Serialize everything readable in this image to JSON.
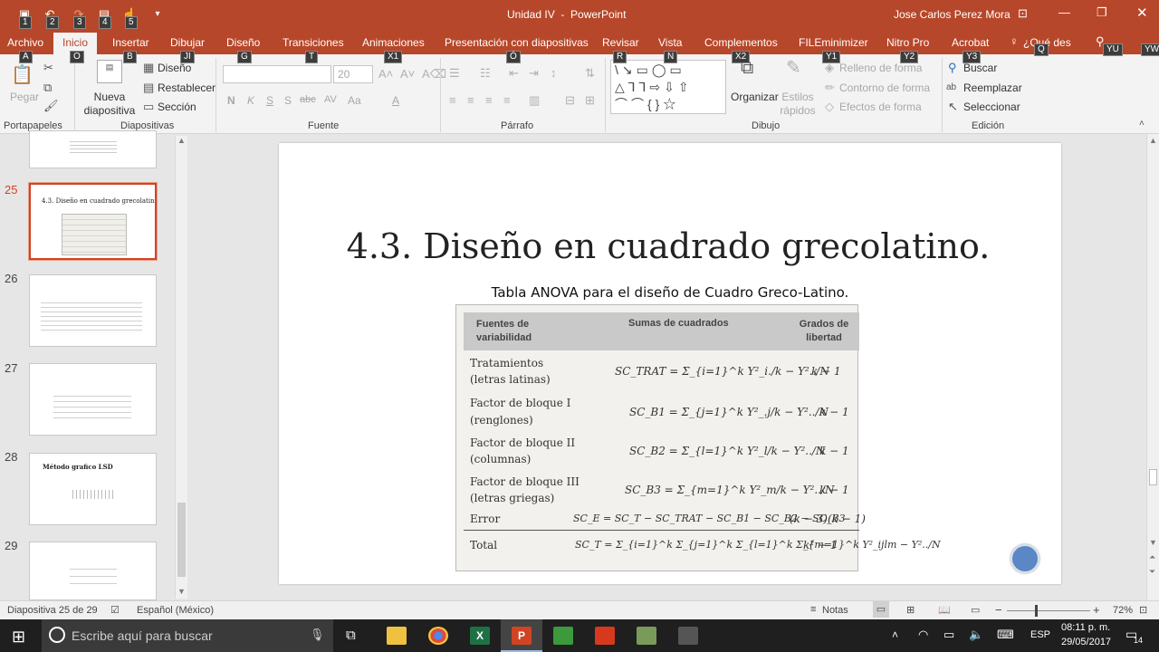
{
  "titlebar": {
    "title": "Unidad IV  -  PowerPoint",
    "user": "Jose Carlos Perez Mora",
    "qat_keytips": [
      "1",
      "2",
      "3",
      "4",
      "5"
    ]
  },
  "tabs": [
    {
      "label": "Archivo",
      "keytip": "A"
    },
    {
      "label": "Inicio",
      "keytip": "O"
    },
    {
      "label": "Insertar",
      "keytip": "B"
    },
    {
      "label": "Dibujar",
      "keytip": "JI"
    },
    {
      "label": "Diseño",
      "keytip": "G"
    },
    {
      "label": "Transiciones",
      "keytip": "T"
    },
    {
      "label": "Animaciones",
      "keytip": "X1"
    },
    {
      "label": "Presentación con diapositivas",
      "keytip": "Ó"
    },
    {
      "label": "Revisar",
      "keytip": "R"
    },
    {
      "label": "Vista",
      "keytip": "N"
    },
    {
      "label": "Complementos",
      "keytip": "X2"
    },
    {
      "label": "FILEminimizer",
      "keytip": "Y1"
    },
    {
      "label": "Nitro Pro",
      "keytip": "Y2"
    },
    {
      "label": "Acrobat",
      "keytip": "Y3"
    },
    {
      "label": "¿Qué des",
      "keytip": "Q"
    },
    {
      "label": "",
      "keytip": "YU"
    },
    {
      "label": "",
      "keytip": "YW"
    }
  ],
  "ribbon": {
    "paste": "Pegar",
    "new_slide": "Nueva diapositiva",
    "layout": "Diseño",
    "reset": "Restablecer",
    "section": "Sección",
    "font_size": "20",
    "arrange": "Organizar",
    "quick_styles": "Estilos rápidos",
    "shape_fill": "Relleno de forma",
    "shape_outline": "Contorno de forma",
    "shape_effects": "Efectos de forma",
    "find": "Buscar",
    "replace": "Reemplazar",
    "select": "Seleccionar",
    "groups": {
      "clipboard": "Portapapeles",
      "slides": "Diapositivas",
      "font": "Fuente",
      "paragraph": "Párrafo",
      "drawing": "Dibujo",
      "editing": "Edición"
    },
    "font_buttons": [
      "N",
      "K",
      "S",
      "S",
      "abc",
      "AV",
      "Aa",
      "A"
    ]
  },
  "thumbnails": [
    {
      "num": "",
      "text": ""
    },
    {
      "num": "25",
      "text": "4.3. Diseño en cuadrado grecolatino."
    },
    {
      "num": "26",
      "text": ""
    },
    {
      "num": "27",
      "text": ""
    },
    {
      "num": "28",
      "text": "Método grafico LSD"
    },
    {
      "num": "29",
      "text": ""
    }
  ],
  "slide": {
    "title": "4.3. Diseño en cuadrado grecolatino.",
    "subtitle": "Tabla ANOVA para el diseño de Cuadro Greco-Latino.",
    "table": {
      "headers": [
        "Fuentes de variabilidad",
        "Sumas de cuadrados",
        "Grados de libertad"
      ],
      "rows": [
        {
          "source": [
            "Tratamientos",
            "(letras latinas)"
          ],
          "ss": "SC_TRAT = Σ_{i=1}^k Y²_i./k − Y²../N",
          "df": "k − 1"
        },
        {
          "source": [
            "Factor de bloque I",
            "(renglones)"
          ],
          "ss": "SC_B1 = Σ_{j=1}^k Y²_.j/k − Y²../N",
          "df": "k − 1"
        },
        {
          "source": [
            "Factor de bloque II",
            "(columnas)"
          ],
          "ss": "SC_B2 = Σ_{l=1}^k Y²_l/k − Y²../N",
          "df": "k − 1"
        },
        {
          "source": [
            "Factor de bloque III",
            "(letras griegas)"
          ],
          "ss": "SC_B3 = Σ_{m=1}^k Y²_m/k − Y²../N",
          "df": "k − 1"
        },
        {
          "source": [
            "Error"
          ],
          "ss": "SC_E = SC_T − SC_TRAT − SC_B1 − SC_B2 − SC_B3",
          "df": "(k − 3)(k − 1)"
        },
        {
          "source": [
            "Total"
          ],
          "ss": "SC_T = Σ_{i=1}^k Σ_{j=1}^k Σ_{l=1}^k Σ_{m=1}^k Y²_ijlm − Y²../N",
          "df": "k² − 1"
        }
      ]
    }
  },
  "status": {
    "slide_info": "Diapositiva 25 de 29",
    "language": "Español (México)",
    "notes": "Notas",
    "zoom": "72%"
  },
  "taskbar": {
    "search_placeholder": "Escribe aquí para buscar",
    "lang": "ESP",
    "time": "08:11 p. m.",
    "date": "29/05/2017",
    "notifications": "14"
  },
  "colors": {
    "accent": "#b7472a",
    "ribbon_bg": "#f3f3f3",
    "taskbar": "#1f1f1f"
  }
}
